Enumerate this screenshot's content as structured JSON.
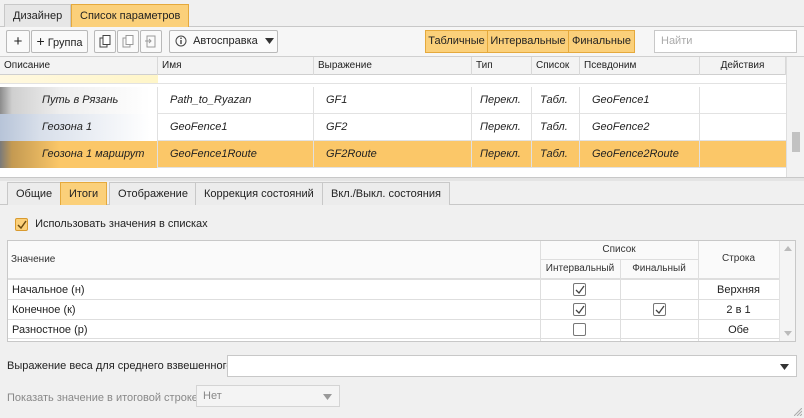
{
  "top_tabs": [
    {
      "label": "Дизайнер"
    },
    {
      "label": "Список параметров"
    }
  ],
  "toolbar": {
    "add_symbol": "+",
    "group_label": "Группа",
    "autohelp_label": "Автосправка",
    "seg": [
      "Табличные",
      "Интервальные",
      "Финальные"
    ],
    "search_placeholder": "Найти"
  },
  "grid": {
    "headers": [
      "Описание",
      "Имя",
      "Выражение",
      "Тип",
      "Список",
      "Псевдоним",
      "Действия"
    ],
    "rows": [
      {
        "desc": "Путь в Рязань",
        "name": "Path_to_Ryazan",
        "expr": "GF1",
        "type": "Перекл.",
        "list": "Табл.",
        "alias": "GeoFence1"
      },
      {
        "desc": "Геозона 1",
        "name": "GeoFence1",
        "expr": "GF2",
        "type": "Перекл.",
        "list": "Табл.",
        "alias": "GeoFence2"
      },
      {
        "desc": "Геозона 1 маршрут",
        "name": "GeoFence1Route",
        "expr": "GF2Route",
        "type": "Перекл.",
        "list": "Табл.",
        "alias": "GeoFence2Route"
      }
    ]
  },
  "lower_tabs": [
    "Общие",
    "Итоги",
    "Отображение",
    "Коррекция состояний",
    "Вкл./Выкл. состояния"
  ],
  "panel": {
    "use_in_lists": "Использовать значения в списках",
    "table": {
      "col_value": "Значение",
      "col_list": "Список",
      "col_interval": "Интервальный",
      "col_final": "Финальный",
      "col_row": "Строка",
      "rows": [
        {
          "label": "Начальное (н)",
          "interval": true,
          "final": false,
          "row": "Верхняя"
        },
        {
          "label": "Конечное (к)",
          "interval": true,
          "final": true,
          "row": "2 в 1"
        },
        {
          "label": "Разностное (р)",
          "interval": false,
          "final": false,
          "row": "Обе"
        }
      ]
    },
    "weight_label": "Выражение веса для среднего взвешенного:",
    "weight_value": "",
    "show_label": "Показать значение в итоговой строке:",
    "show_value": "Нет"
  }
}
